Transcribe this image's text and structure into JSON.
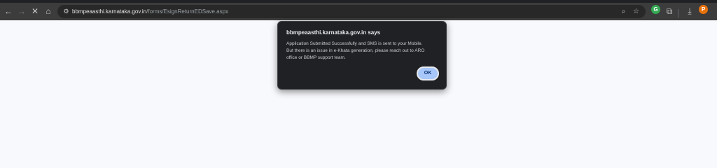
{
  "browser": {
    "url_host": "bbmpeaasthi.karnataka.gov.in",
    "url_path": "/forms/EsignReturnEDSave.aspx",
    "icons": {
      "back": "back-arrow-icon",
      "forward": "forward-arrow-icon",
      "stop": "close-icon",
      "home": "home-icon",
      "site_info": "site-info-icon",
      "zoom": "zoom-icon",
      "bookmark": "star-icon",
      "extension": "extension-icon",
      "extensions_menu": "puzzle-icon",
      "download": "download-icon",
      "profile": "profile-avatar"
    },
    "profile_initial": "P",
    "colors": {
      "toolbar": "#3c3c3c",
      "omnibox": "#282828",
      "profile": "#e8710a",
      "extension": "#34a853"
    }
  },
  "dialog": {
    "title": "bbmpeaasthi.karnataka.gov.in says",
    "message_lines": [
      "Application Submitted Successfully and SMS is sent to your Mobile.",
      "But there is an issue in e-Khata generation, please reach out to ARO",
      "office or BBMP support team."
    ],
    "ok_label": "OK",
    "colors": {
      "background": "#202124",
      "button": "#a8c7fa"
    }
  }
}
